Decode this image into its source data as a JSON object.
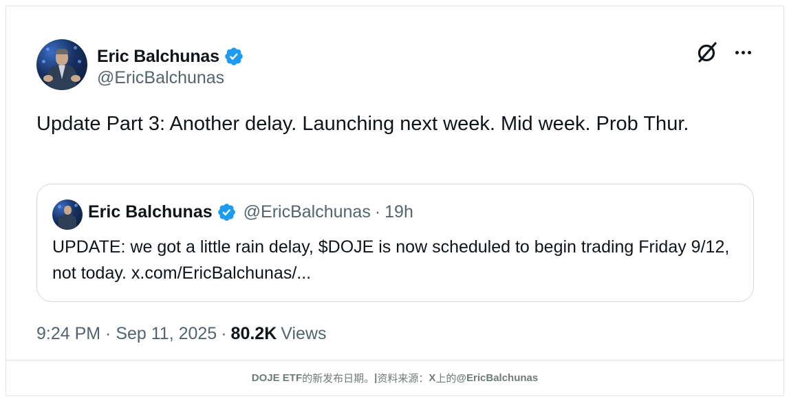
{
  "tweet": {
    "author_name": "Eric Balchunas",
    "author_handle": "@EricBalchunas",
    "text": "Update Part 3: Another delay. Launching next week. Mid week. Prob Thur.",
    "timestamp": "9:24 PM · Sep 11, 2025",
    "views_count": "80.2K",
    "views_label": "Views",
    "icons": {
      "verified": "verified-badge-icon",
      "brand": "grok-logo-icon",
      "more": "more-options-icon"
    },
    "accent_color": "#1d9bf0"
  },
  "quote": {
    "author_name": "Eric Balchunas",
    "author_handle": "@EricBalchunas",
    "separator": "·",
    "time_ago": "19h",
    "text": "UPDATE: we got a little rain delay, $DOJE is now scheduled to begin trading Friday 9/12, not today. x.com/EricBalchunas/..."
  },
  "footer": {
    "part1": "DOJE ETF",
    "part2": " 的新发布日期。",
    "part3": "|",
    "part4": " 资料来源：",
    "part5": "X",
    "part6": " 上的 ",
    "part7": "@EricBalchunas"
  }
}
